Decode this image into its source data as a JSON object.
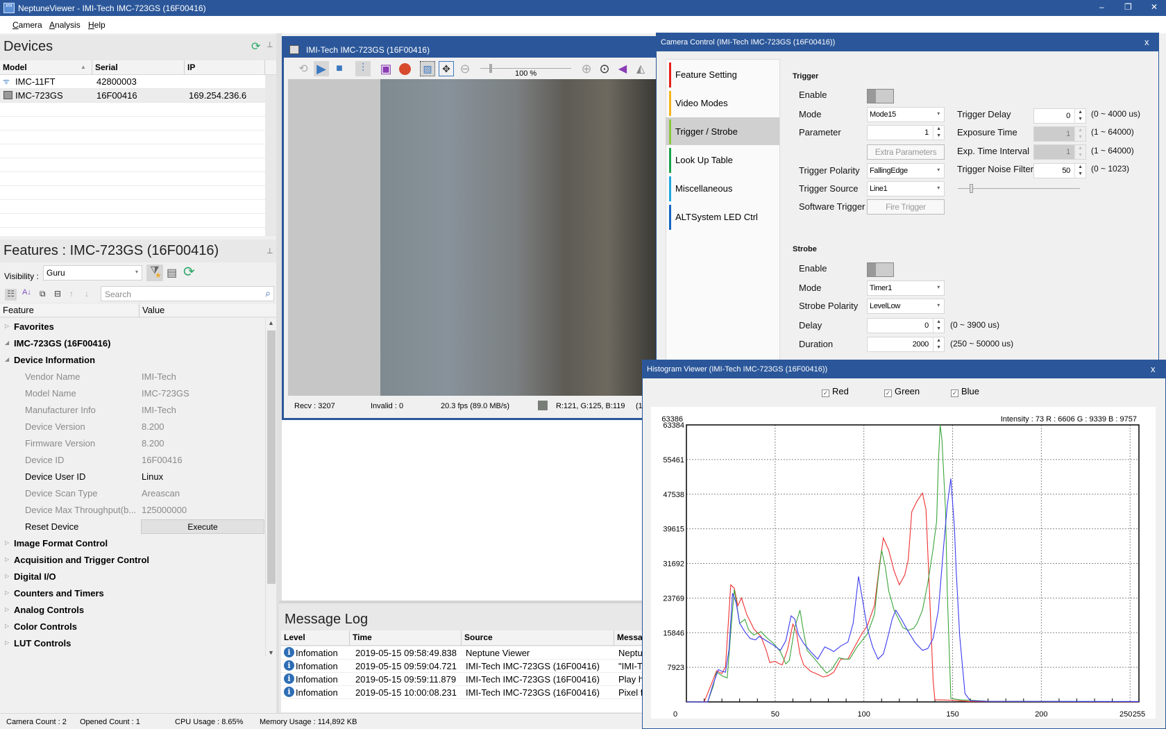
{
  "app": {
    "title": "NeptuneViewer - IMI-Tech IMC-723GS (16F00416)",
    "minimize": "–",
    "restore": "❐",
    "close": "✕"
  },
  "menu": [
    "Camera",
    "Analysis",
    "Help"
  ],
  "devices": {
    "title": "Devices",
    "columns": [
      "Model",
      "Serial",
      "IP"
    ],
    "rows": [
      {
        "model": "IMC-11FT",
        "serial": "42800003",
        "ip": ""
      },
      {
        "model": "IMC-723GS",
        "serial": "16F00416",
        "ip": "169.254.236.6"
      }
    ]
  },
  "features": {
    "title": "Features : IMC-723GS (16F00416)",
    "visibility_label": "Visibility :",
    "visibility_value": "Guru",
    "search_placeholder": "Search",
    "columns": [
      "Feature",
      "Value"
    ],
    "tree": [
      {
        "label": "Favorites",
        "level": 0,
        "type": "group",
        "collapsed": true
      },
      {
        "label": "IMC-723GS (16F00416)",
        "level": 0,
        "type": "group",
        "collapsed": false
      },
      {
        "label": "Device Information",
        "level": 1,
        "type": "group",
        "collapsed": false
      },
      {
        "label": "Vendor Name",
        "value": "IMI-Tech",
        "level": 2,
        "readonly": true
      },
      {
        "label": "Model Name",
        "value": "IMC-723GS",
        "level": 2,
        "readonly": true
      },
      {
        "label": "Manufacturer Info",
        "value": "IMI-Tech",
        "level": 2,
        "readonly": true
      },
      {
        "label": "Device Version",
        "value": "8.200",
        "level": 2,
        "readonly": true
      },
      {
        "label": "Firmware Version",
        "value": "8.200",
        "level": 2,
        "readonly": true
      },
      {
        "label": "Device ID",
        "value": "16F00416",
        "level": 2,
        "readonly": true
      },
      {
        "label": "Device User ID",
        "value": "Linux",
        "level": 2,
        "readonly": false
      },
      {
        "label": "Device Scan Type",
        "value": "Areascan",
        "level": 2,
        "readonly": true
      },
      {
        "label": "Device Max Throughput(b...",
        "value": "125000000",
        "level": 2,
        "readonly": true
      },
      {
        "label": "Reset Device",
        "value": "Execute",
        "level": 2,
        "readonly": false,
        "button": true
      },
      {
        "label": "Image Format Control",
        "level": 1,
        "type": "group",
        "collapsed": true
      },
      {
        "label": "Acquisition and Trigger Control",
        "level": 1,
        "type": "group",
        "collapsed": true
      },
      {
        "label": "Digital I/O",
        "level": 1,
        "type": "group",
        "collapsed": true
      },
      {
        "label": "Counters and Timers",
        "level": 1,
        "type": "group",
        "collapsed": true
      },
      {
        "label": "Analog Controls",
        "level": 1,
        "type": "group",
        "collapsed": true
      },
      {
        "label": "Color Controls",
        "level": 1,
        "type": "group",
        "collapsed": true
      },
      {
        "label": "LUT Controls",
        "level": 1,
        "type": "group",
        "collapsed": true
      }
    ]
  },
  "viewer": {
    "title": "IMI-Tech IMC-723GS (16F00416)",
    "zoom": "100 %",
    "zoom_fraction": 0.1,
    "status": {
      "recv": "Recv : 3207",
      "invalid": "Invalid : 0",
      "fps": "20.3 fps (89.0 MB/s)",
      "pixel": "R:121, G:125, B:119",
      "extra": "(1",
      "swatch": "#797d77"
    }
  },
  "log": {
    "title": "Message Log",
    "columns": [
      "Level",
      "Time",
      "Source",
      "Message"
    ],
    "rows": [
      {
        "level": "Infomation",
        "time": "2019-05-15 09:58:49.838",
        "source": "Neptune Viewer",
        "message": "Neptu"
      },
      {
        "level": "Infomation",
        "time": "2019-05-15 09:59:04.721",
        "source": "IMI-Tech IMC-723GS (16F00416)",
        "message": "\"IMI-T"
      },
      {
        "level": "Infomation",
        "time": "2019-05-15 09:59:11.879",
        "source": "IMI-Tech IMC-723GS (16F00416)",
        "message": "Play h"
      },
      {
        "level": "Infomation",
        "time": "2019-05-15 10:00:08.231",
        "source": "IMI-Tech IMC-723GS (16F00416)",
        "message": "Pixel f"
      }
    ]
  },
  "statusbar": {
    "camera_count": "Camera Count : 2",
    "opened_count": "Opened Count : 1",
    "cpu": "CPU Usage : 8.65%",
    "memory": "Memory Usage : 114,892 KB"
  },
  "camera_control": {
    "title": "Camera Control (IMI-Tech IMC-723GS (16F00416))",
    "close": "x",
    "nav": [
      {
        "label": "Feature Setting",
        "color": "#e8201c"
      },
      {
        "label": "Video Modes",
        "color": "#f4b41a"
      },
      {
        "label": "Trigger / Strobe",
        "color": "#8cc63f",
        "selected": true
      },
      {
        "label": "Look Up Table",
        "color": "#1aa34a"
      },
      {
        "label": "Miscellaneous",
        "color": "#1ea7e1"
      },
      {
        "label": "ALTSystem LED Ctrl",
        "color": "#1565c0"
      }
    ],
    "trigger": {
      "heading": "Trigger",
      "enable_label": "Enable",
      "mode_label": "Mode",
      "mode": "Mode15",
      "parameter_label": "Parameter",
      "parameter": "1",
      "extra_button": "Extra Parameters",
      "polarity_label": "Trigger Polarity",
      "polarity": "FallingEdge",
      "source_label": "Trigger Source",
      "source": "Line1",
      "software_label": "Software Trigger",
      "fire_button": "Fire Trigger",
      "delay_label": "Trigger Delay",
      "delay": "0",
      "delay_range": "(0 ~ 4000 us)",
      "exposure_label": "Exposure Time",
      "exposure": "1",
      "exposure_range": "(1 ~ 64000)",
      "interval_label": "Exp. Time Interval",
      "interval": "1",
      "interval_range": "(1 ~ 64000)",
      "noise_label": "Trigger Noise Filter",
      "noise": "50",
      "noise_range": "(0 ~ 1023)",
      "noise_fraction": 0.049
    },
    "strobe": {
      "heading": "Strobe",
      "enable_label": "Enable",
      "mode_label": "Mode",
      "mode": "Timer1",
      "polarity_label": "Strobe Polarity",
      "polarity": "LevelLow",
      "delay_label": "Delay",
      "delay": "0",
      "delay_range": "(0 ~ 3900 us)",
      "duration_label": "Duration",
      "duration": "2000",
      "duration_range": "(250 ~ 50000 us)"
    }
  },
  "histogram": {
    "title": "Histogram Viewer (IMI-Tech IMC-723GS (16F00416))",
    "close": "x",
    "checks": [
      "Red",
      "Green",
      "Blue"
    ]
  },
  "chart_data": {
    "type": "line",
    "title": "",
    "xlabel": "",
    "ylabel": "",
    "readout": "Intensity : 73    R : 6606    G : 9339    B : 9757",
    "max_label": "63386",
    "xlim": [
      0,
      255
    ],
    "ylim": [
      0,
      63384
    ],
    "xticks": [
      "0",
      "50",
      "100",
      "150",
      "200",
      "250",
      "255"
    ],
    "yticks": [
      "63384",
      "55461",
      "47538",
      "39615",
      "31692",
      "23769",
      "15846",
      "7923"
    ],
    "grid": true,
    "series": [
      {
        "name": "Red",
        "color": "#f03030",
        "points": [
          [
            0,
            0
          ],
          [
            10,
            0
          ],
          [
            14,
            4000
          ],
          [
            17,
            7100
          ],
          [
            20,
            6500
          ],
          [
            22,
            8000
          ],
          [
            25,
            26800
          ],
          [
            27,
            26000
          ],
          [
            29,
            22000
          ],
          [
            31,
            23800
          ],
          [
            34,
            20000
          ],
          [
            38,
            16700
          ],
          [
            42,
            15000
          ],
          [
            45,
            11760
          ],
          [
            47,
            9000
          ],
          [
            50,
            9300
          ],
          [
            52,
            8800
          ],
          [
            54,
            8500
          ],
          [
            57,
            12000
          ],
          [
            60,
            17800
          ],
          [
            62,
            16000
          ],
          [
            64,
            11000
          ],
          [
            66,
            8500
          ],
          [
            70,
            7000
          ],
          [
            74,
            6300
          ],
          [
            77,
            5700
          ],
          [
            80,
            6000
          ],
          [
            83,
            6800
          ],
          [
            87,
            9800
          ],
          [
            91,
            9800
          ],
          [
            94,
            12000
          ],
          [
            98,
            15000
          ],
          [
            102,
            17500
          ],
          [
            106,
            22100
          ],
          [
            109,
            32000
          ],
          [
            111,
            37500
          ],
          [
            114,
            34700
          ],
          [
            117,
            30000
          ],
          [
            120,
            26800
          ],
          [
            123,
            29000
          ],
          [
            125,
            32500
          ],
          [
            127,
            43500
          ],
          [
            130,
            46000
          ],
          [
            133,
            47800
          ],
          [
            135,
            44000
          ],
          [
            137,
            25000
          ],
          [
            139,
            5000
          ],
          [
            140,
            500
          ],
          [
            145,
            450
          ],
          [
            149,
            400
          ],
          [
            155,
            250
          ],
          [
            160,
            100
          ],
          [
            255,
            50
          ]
        ]
      },
      {
        "name": "Green",
        "color": "#3aa53a",
        "points": [
          [
            0,
            0
          ],
          [
            12,
            0
          ],
          [
            15,
            3500
          ],
          [
            17,
            6800
          ],
          [
            20,
            6000
          ],
          [
            23,
            5500
          ],
          [
            25,
            16000
          ],
          [
            27,
            25700
          ],
          [
            30,
            18000
          ],
          [
            33,
            18900
          ],
          [
            35,
            16500
          ],
          [
            38,
            15300
          ],
          [
            42,
            16100
          ],
          [
            45,
            14800
          ],
          [
            49,
            13400
          ],
          [
            53,
            11500
          ],
          [
            56,
            8700
          ],
          [
            58,
            9500
          ],
          [
            61,
            17000
          ],
          [
            64,
            21000
          ],
          [
            66,
            16000
          ],
          [
            68,
            11800
          ],
          [
            72,
            10000
          ],
          [
            76,
            8000
          ],
          [
            79,
            6600
          ],
          [
            82,
            7500
          ],
          [
            86,
            10100
          ],
          [
            89,
            9800
          ],
          [
            92,
            9800
          ],
          [
            96,
            12500
          ],
          [
            102,
            15600
          ],
          [
            106,
            20000
          ],
          [
            108,
            28000
          ],
          [
            110,
            34700
          ],
          [
            112,
            31000
          ],
          [
            114,
            25400
          ],
          [
            117,
            21000
          ],
          [
            119,
            19400
          ],
          [
            122,
            17000
          ],
          [
            125,
            16400
          ],
          [
            128,
            16800
          ],
          [
            130,
            18000
          ],
          [
            133,
            21000
          ],
          [
            136,
            27100
          ],
          [
            139,
            35000
          ],
          [
            141,
            41300
          ],
          [
            142,
            55000
          ],
          [
            143,
            63384
          ],
          [
            144,
            60000
          ],
          [
            146,
            44000
          ],
          [
            147,
            25000
          ],
          [
            149,
            800
          ],
          [
            154,
            500
          ],
          [
            159,
            400
          ],
          [
            170,
            150
          ],
          [
            255,
            80
          ]
        ]
      },
      {
        "name": "Blue",
        "color": "#3a3af0",
        "points": [
          [
            0,
            0
          ],
          [
            12,
            0
          ],
          [
            15,
            4000
          ],
          [
            18,
            7400
          ],
          [
            20,
            7000
          ],
          [
            22,
            6800
          ],
          [
            24,
            12000
          ],
          [
            26,
            24900
          ],
          [
            28,
            22700
          ],
          [
            30,
            18000
          ],
          [
            33,
            16000
          ],
          [
            36,
            14500
          ],
          [
            39,
            14200
          ],
          [
            41,
            15000
          ],
          [
            45,
            14000
          ],
          [
            49,
            13000
          ],
          [
            53,
            11800
          ],
          [
            56,
            14000
          ],
          [
            59,
            19700
          ],
          [
            61,
            19000
          ],
          [
            63,
            15500
          ],
          [
            66,
            13400
          ],
          [
            70,
            11500
          ],
          [
            74,
            9800
          ],
          [
            78,
            12600
          ],
          [
            81,
            12000
          ],
          [
            83,
            11500
          ],
          [
            87,
            12800
          ],
          [
            91,
            13700
          ],
          [
            94,
            18000
          ],
          [
            97,
            28700
          ],
          [
            99,
            24000
          ],
          [
            102,
            16700
          ],
          [
            105,
            12500
          ],
          [
            108,
            9800
          ],
          [
            111,
            11000
          ],
          [
            113,
            14000
          ],
          [
            116,
            19000
          ],
          [
            118,
            21000
          ],
          [
            121,
            19000
          ],
          [
            125,
            16100
          ],
          [
            129,
            13500
          ],
          [
            133,
            11800
          ],
          [
            136,
            12200
          ],
          [
            139,
            14500
          ],
          [
            142,
            21000
          ],
          [
            145,
            35800
          ],
          [
            147,
            45000
          ],
          [
            149,
            51100
          ],
          [
            151,
            40000
          ],
          [
            152,
            30300
          ],
          [
            154,
            15000
          ],
          [
            157,
            1900
          ],
          [
            160,
            270
          ],
          [
            170,
            120
          ],
          [
            255,
            100
          ]
        ]
      }
    ]
  }
}
